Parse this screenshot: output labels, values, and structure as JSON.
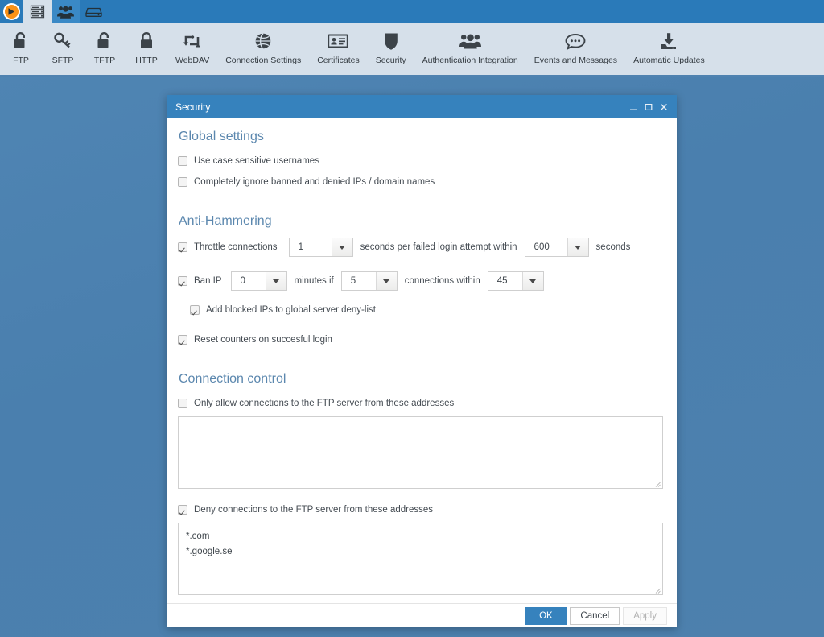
{
  "app": {
    "logo_icon": "orange-play-arrow-logo",
    "tabs": [
      {
        "name": "server",
        "icon": "server-stack-icon",
        "state": "active"
      },
      {
        "name": "users",
        "icon": "users-group-icon",
        "state": "hover"
      },
      {
        "name": "storage",
        "icon": "disk-drive-icon",
        "state": "normal"
      }
    ]
  },
  "ribbon": {
    "items": [
      {
        "label": "FTP",
        "icon": "open-padlock-icon"
      },
      {
        "label": "SFTP",
        "icon": "key-icon"
      },
      {
        "label": "TFTP",
        "icon": "open-padlock-icon"
      },
      {
        "label": "HTTP",
        "icon": "closed-padlock-icon"
      },
      {
        "label": "WebDAV",
        "icon": "sync-arrows-icon"
      },
      {
        "label": "Connection Settings",
        "icon": "globe-icon"
      },
      {
        "label": "Certificates",
        "icon": "id-card-icon"
      },
      {
        "label": "Security",
        "icon": "shield-icon"
      },
      {
        "label": "Authentication Integration",
        "icon": "users-group-icon"
      },
      {
        "label": "Events and Messages",
        "icon": "speech-bubble-icon"
      },
      {
        "label": "Automatic Updates",
        "icon": "download-tray-icon"
      }
    ]
  },
  "dialog": {
    "title": "Security",
    "window_buttons": {
      "minimize": "minimize-icon",
      "maximize": "maximize-icon",
      "close": "close-icon"
    },
    "sections": {
      "global": {
        "title": "Global settings",
        "options": [
          {
            "label": "Use case sensitive usernames",
            "checked": false
          },
          {
            "label": "Completely ignore banned and denied IPs / domain names",
            "checked": false
          }
        ]
      },
      "anti_hammering": {
        "title": "Anti-Hammering",
        "throttle": {
          "label": "Throttle connections",
          "checked": true,
          "seconds_value": "1",
          "mid_label": "seconds per failed login attempt within",
          "window_value": "600",
          "tail_label": "seconds"
        },
        "ban_ip": {
          "label": "Ban IP",
          "checked": true,
          "minutes_value": "0",
          "mid_label": "minutes if",
          "connections_value": "5",
          "mid_label_2": "connections within",
          "window_value": "45"
        },
        "deny_list": {
          "label": "Add blocked IPs to global server deny-list",
          "checked": true
        },
        "reset_counters": {
          "label": "Reset counters on succesful login",
          "checked": true
        }
      },
      "connection_control": {
        "title": "Connection control",
        "allow": {
          "label": "Only allow connections to the FTP server from these addresses",
          "checked": false,
          "value": "",
          "placeholder": ""
        },
        "deny": {
          "label": "Deny connections to the FTP server from these addresses",
          "checked": true,
          "value": "*.com\n*.google.se",
          "placeholder": ""
        }
      }
    },
    "footer": {
      "ok": "OK",
      "cancel": "Cancel",
      "apply": "Apply",
      "apply_enabled": false
    }
  },
  "colors": {
    "accent_blue": "#3682bd",
    "tab_blue": "#2a7ab9",
    "ribbon_bg": "#d6e0ea",
    "desktop_blue": "#4a7fae",
    "section_heading": "#5b87ae",
    "logo_orange": "#fa9216",
    "icon_dark": "#3c4349"
  }
}
